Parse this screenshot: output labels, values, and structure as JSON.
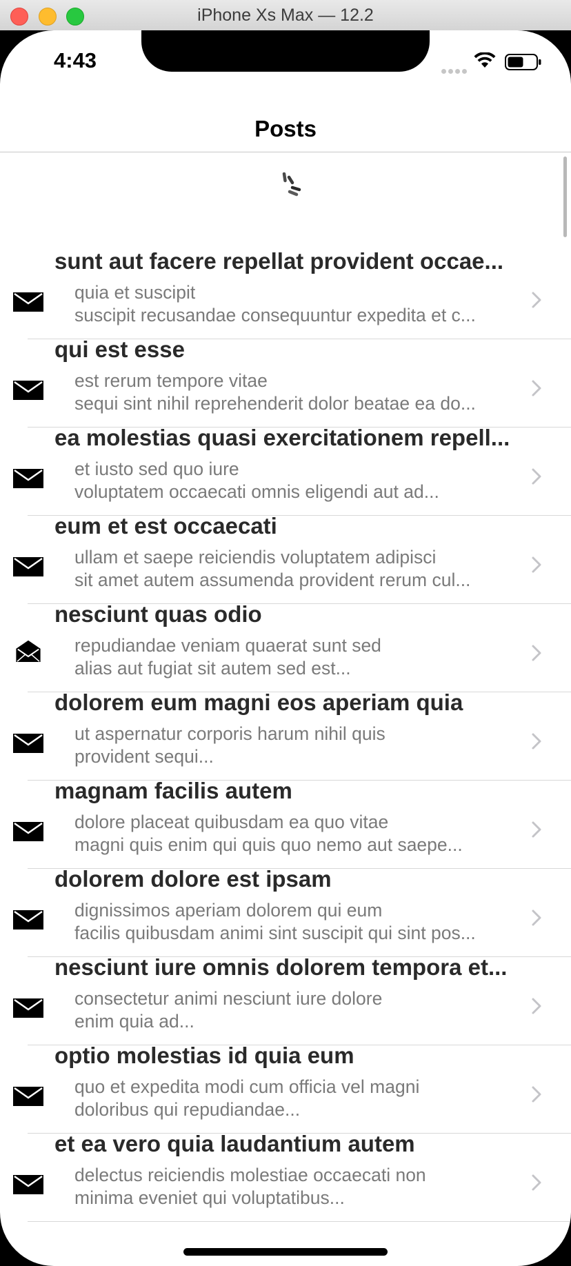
{
  "window": {
    "title": "iPhone Xs Max — 12.2"
  },
  "status_bar": {
    "time": "4:43"
  },
  "nav": {
    "title": "Posts"
  },
  "colors": {
    "title_text": "#2a2a2a",
    "subtitle_text": "#7a7a7a",
    "chevron": "#c4c4c8",
    "separator": "#d8d8d8"
  },
  "posts": [
    {
      "title": "sunt aut facere repellat provident occae...",
      "line1": "quia et suscipit",
      "line2": "suscipit recusandae consequuntur expedita et c...",
      "icon": "envelope-closed"
    },
    {
      "title": "qui est esse",
      "line1": "est rerum tempore vitae",
      "line2": "sequi sint nihil reprehenderit dolor beatae ea do...",
      "icon": "envelope-closed"
    },
    {
      "title": "ea molestias quasi exercitationem repell...",
      "line1": "et iusto sed quo iure",
      "line2": "voluptatem occaecati omnis eligendi aut ad...",
      "icon": "envelope-closed"
    },
    {
      "title": "eum et est occaecati",
      "line1": "ullam et saepe reiciendis voluptatem adipisci",
      "line2": "sit amet autem assumenda provident rerum cul...",
      "icon": "envelope-closed"
    },
    {
      "title": "nesciunt quas odio",
      "line1": "repudiandae veniam quaerat sunt sed",
      "line2": "alias aut fugiat sit autem sed est...",
      "icon": "envelope-open"
    },
    {
      "title": "dolorem eum magni eos aperiam quia",
      "line1": "ut aspernatur corporis harum nihil quis",
      "line2": "provident sequi...",
      "icon": "envelope-closed"
    },
    {
      "title": "magnam facilis autem",
      "line1": "dolore placeat quibusdam ea quo vitae",
      "line2": "magni quis enim qui quis quo nemo aut saepe...",
      "icon": "envelope-closed"
    },
    {
      "title": "dolorem dolore est ipsam",
      "line1": "dignissimos aperiam dolorem qui eum",
      "line2": "facilis quibusdam animi sint suscipit qui sint pos...",
      "icon": "envelope-closed"
    },
    {
      "title": "nesciunt iure omnis dolorem tempora et...",
      "line1": "consectetur animi nesciunt iure dolore",
      "line2": "enim quia ad...",
      "icon": "envelope-closed"
    },
    {
      "title": "optio molestias id quia eum",
      "line1": "quo et expedita modi cum officia vel magni",
      "line2": "doloribus qui repudiandae...",
      "icon": "envelope-closed"
    },
    {
      "title": "et ea vero quia laudantium autem",
      "line1": "delectus reiciendis molestiae occaecati non",
      "line2": "minima eveniet qui voluptatibus...",
      "icon": "envelope-closed"
    }
  ]
}
